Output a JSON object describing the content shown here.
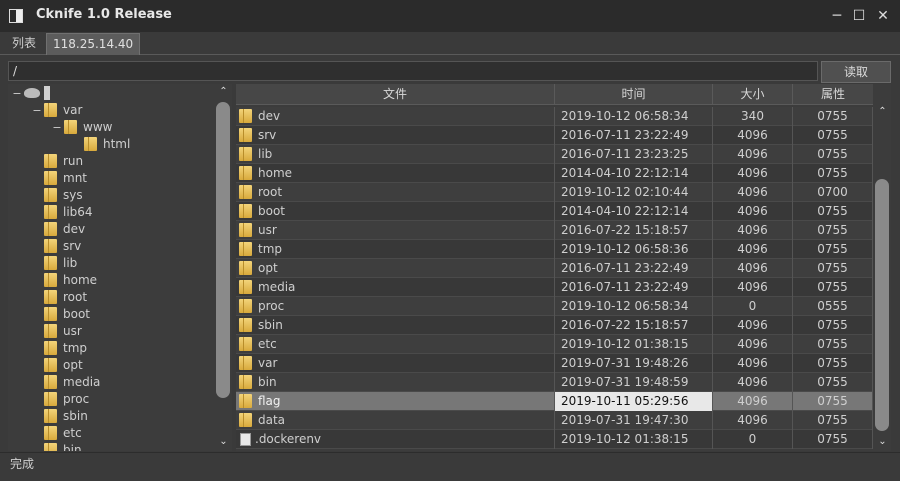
{
  "window": {
    "title": "Cknife 1.0 Release",
    "min_glyph": "─",
    "max_glyph": "☐",
    "close_glyph": "✕"
  },
  "tabs": [
    {
      "label": "列表"
    },
    {
      "label": "118.25.14.40"
    }
  ],
  "path": {
    "value": "/",
    "read_button": "读取"
  },
  "tree": [
    {
      "label": "/",
      "depth": 0,
      "expander": "−",
      "root": true
    },
    {
      "label": "var",
      "depth": 1,
      "expander": "−"
    },
    {
      "label": "www",
      "depth": 2,
      "expander": "−"
    },
    {
      "label": "html",
      "depth": 3,
      "expander": ""
    },
    {
      "label": "run",
      "depth": 1,
      "expander": ""
    },
    {
      "label": "mnt",
      "depth": 1,
      "expander": ""
    },
    {
      "label": "sys",
      "depth": 1,
      "expander": ""
    },
    {
      "label": "lib64",
      "depth": 1,
      "expander": ""
    },
    {
      "label": "dev",
      "depth": 1,
      "expander": ""
    },
    {
      "label": "srv",
      "depth": 1,
      "expander": ""
    },
    {
      "label": "lib",
      "depth": 1,
      "expander": ""
    },
    {
      "label": "home",
      "depth": 1,
      "expander": ""
    },
    {
      "label": "root",
      "depth": 1,
      "expander": ""
    },
    {
      "label": "boot",
      "depth": 1,
      "expander": ""
    },
    {
      "label": "usr",
      "depth": 1,
      "expander": ""
    },
    {
      "label": "tmp",
      "depth": 1,
      "expander": ""
    },
    {
      "label": "opt",
      "depth": 1,
      "expander": ""
    },
    {
      "label": "media",
      "depth": 1,
      "expander": ""
    },
    {
      "label": "proc",
      "depth": 1,
      "expander": ""
    },
    {
      "label": "sbin",
      "depth": 1,
      "expander": ""
    },
    {
      "label": "etc",
      "depth": 1,
      "expander": ""
    },
    {
      "label": "bin",
      "depth": 1,
      "expander": ""
    }
  ],
  "files": {
    "headers": {
      "name": "文件",
      "time": "时间",
      "size": "大小",
      "perm": "属性"
    },
    "rows": [
      {
        "name": "dev",
        "time": "2019-10-12 06:58:34",
        "size": "340",
        "perm": "0755",
        "type": "folder"
      },
      {
        "name": "srv",
        "time": "2016-07-11 23:22:49",
        "size": "4096",
        "perm": "0755",
        "type": "folder"
      },
      {
        "name": "lib",
        "time": "2016-07-11 23:23:25",
        "size": "4096",
        "perm": "0755",
        "type": "folder"
      },
      {
        "name": "home",
        "time": "2014-04-10 22:12:14",
        "size": "4096",
        "perm": "0755",
        "type": "folder"
      },
      {
        "name": "root",
        "time": "2019-10-12 02:10:44",
        "size": "4096",
        "perm": "0700",
        "type": "folder"
      },
      {
        "name": "boot",
        "time": "2014-04-10 22:12:14",
        "size": "4096",
        "perm": "0755",
        "type": "folder"
      },
      {
        "name": "usr",
        "time": "2016-07-22 15:18:57",
        "size": "4096",
        "perm": "0755",
        "type": "folder"
      },
      {
        "name": "tmp",
        "time": "2019-10-12 06:58:36",
        "size": "4096",
        "perm": "0755",
        "type": "folder"
      },
      {
        "name": "opt",
        "time": "2016-07-11 23:22:49",
        "size": "4096",
        "perm": "0755",
        "type": "folder"
      },
      {
        "name": "media",
        "time": "2016-07-11 23:22:49",
        "size": "4096",
        "perm": "0755",
        "type": "folder"
      },
      {
        "name": "proc",
        "time": "2019-10-12 06:58:34",
        "size": "0",
        "perm": "0555",
        "type": "folder"
      },
      {
        "name": "sbin",
        "time": "2016-07-22 15:18:57",
        "size": "4096",
        "perm": "0755",
        "type": "folder"
      },
      {
        "name": "etc",
        "time": "2019-10-12 01:38:15",
        "size": "4096",
        "perm": "0755",
        "type": "folder"
      },
      {
        "name": "var",
        "time": "2019-07-31 19:48:26",
        "size": "4096",
        "perm": "0755",
        "type": "folder"
      },
      {
        "name": "bin",
        "time": "2019-07-31 19:48:59",
        "size": "4096",
        "perm": "0755",
        "type": "folder"
      },
      {
        "name": "flag",
        "time": "2019-10-11 05:29:56",
        "size": "4096",
        "perm": "0755",
        "type": "folder",
        "selected": true
      },
      {
        "name": "data",
        "time": "2019-07-31 19:47:30",
        "size": "4096",
        "perm": "0755",
        "type": "folder"
      },
      {
        "name": ".dockerenv",
        "time": "2019-10-12 01:38:15",
        "size": "0",
        "perm": "0755",
        "type": "file"
      }
    ]
  },
  "status": {
    "text": "完成"
  },
  "icons": {
    "scroll_up": "▲",
    "scroll_down": "▼",
    "up_glyph": "⌃",
    "down_glyph": "⌄"
  }
}
